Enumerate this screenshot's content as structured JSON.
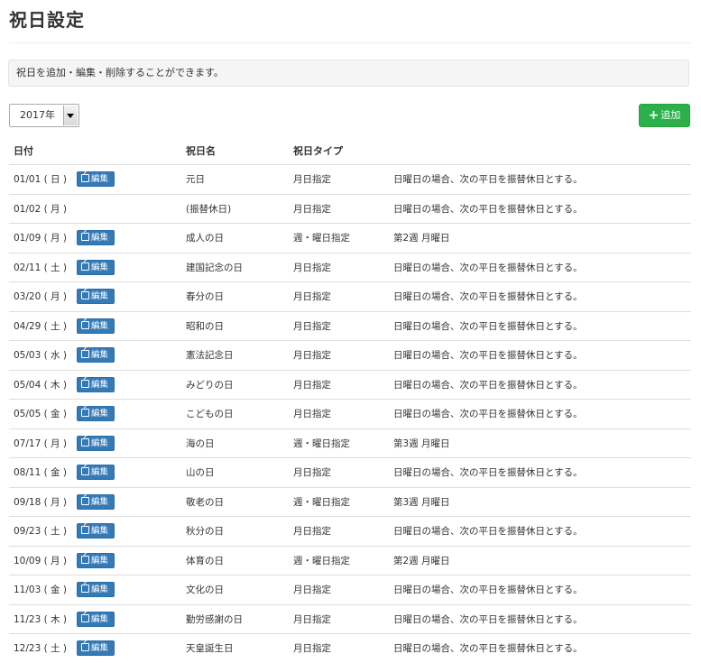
{
  "page": {
    "title": "祝日設定",
    "description": "祝日を追加・編集・削除することができます。"
  },
  "controls": {
    "year": "2017年",
    "add_label": "追加",
    "add_icon": "plus-icon"
  },
  "table": {
    "headers": [
      "日付",
      "",
      "祝日名",
      "祝日タイプ",
      ""
    ],
    "edit_label": "編集",
    "rows": [
      {
        "date": "01/01 ( 日 )",
        "edit": true,
        "name": "元日",
        "type": "月日指定",
        "rule": "日曜日の場合、次の平日を振替休日とする。"
      },
      {
        "date": "01/02 ( 月 )",
        "edit": false,
        "name": "(振替休日)",
        "type": "月日指定",
        "rule": "日曜日の場合、次の平日を振替休日とする。"
      },
      {
        "date": "01/09 ( 月 )",
        "edit": true,
        "name": "成人の日",
        "type": "週・曜日指定",
        "rule": "第2週 月曜日"
      },
      {
        "date": "02/11 ( 土 )",
        "edit": true,
        "name": "建国記念の日",
        "type": "月日指定",
        "rule": "日曜日の場合、次の平日を振替休日とする。"
      },
      {
        "date": "03/20 ( 月 )",
        "edit": true,
        "name": "春分の日",
        "type": "月日指定",
        "rule": "日曜日の場合、次の平日を振替休日とする。"
      },
      {
        "date": "04/29 ( 土 )",
        "edit": true,
        "name": "昭和の日",
        "type": "月日指定",
        "rule": "日曜日の場合、次の平日を振替休日とする。"
      },
      {
        "date": "05/03 ( 水 )",
        "edit": true,
        "name": "憲法記念日",
        "type": "月日指定",
        "rule": "日曜日の場合、次の平日を振替休日とする。"
      },
      {
        "date": "05/04 ( 木 )",
        "edit": true,
        "name": "みどりの日",
        "type": "月日指定",
        "rule": "日曜日の場合、次の平日を振替休日とする。"
      },
      {
        "date": "05/05 ( 金 )",
        "edit": true,
        "name": "こどもの日",
        "type": "月日指定",
        "rule": "日曜日の場合、次の平日を振替休日とする。"
      },
      {
        "date": "07/17 ( 月 )",
        "edit": true,
        "name": "海の日",
        "type": "週・曜日指定",
        "rule": "第3週 月曜日"
      },
      {
        "date": "08/11 ( 金 )",
        "edit": true,
        "name": "山の日",
        "type": "月日指定",
        "rule": "日曜日の場合、次の平日を振替休日とする。"
      },
      {
        "date": "09/18 ( 月 )",
        "edit": true,
        "name": "敬老の日",
        "type": "週・曜日指定",
        "rule": "第3週 月曜日"
      },
      {
        "date": "09/23 ( 土 )",
        "edit": true,
        "name": "秋分の日",
        "type": "月日指定",
        "rule": "日曜日の場合、次の平日を振替休日とする。"
      },
      {
        "date": "10/09 ( 月 )",
        "edit": true,
        "name": "体育の日",
        "type": "週・曜日指定",
        "rule": "第2週 月曜日"
      },
      {
        "date": "11/03 ( 金 )",
        "edit": true,
        "name": "文化の日",
        "type": "月日指定",
        "rule": "日曜日の場合、次の平日を振替休日とする。"
      },
      {
        "date": "11/23 ( 木 )",
        "edit": true,
        "name": "勤労感謝の日",
        "type": "月日指定",
        "rule": "日曜日の場合、次の平日を振替休日とする。"
      },
      {
        "date": "12/23 ( 土 )",
        "edit": true,
        "name": "天皇誕生日",
        "type": "月日指定",
        "rule": "日曜日の場合、次の平日を振替休日とする。"
      }
    ]
  }
}
